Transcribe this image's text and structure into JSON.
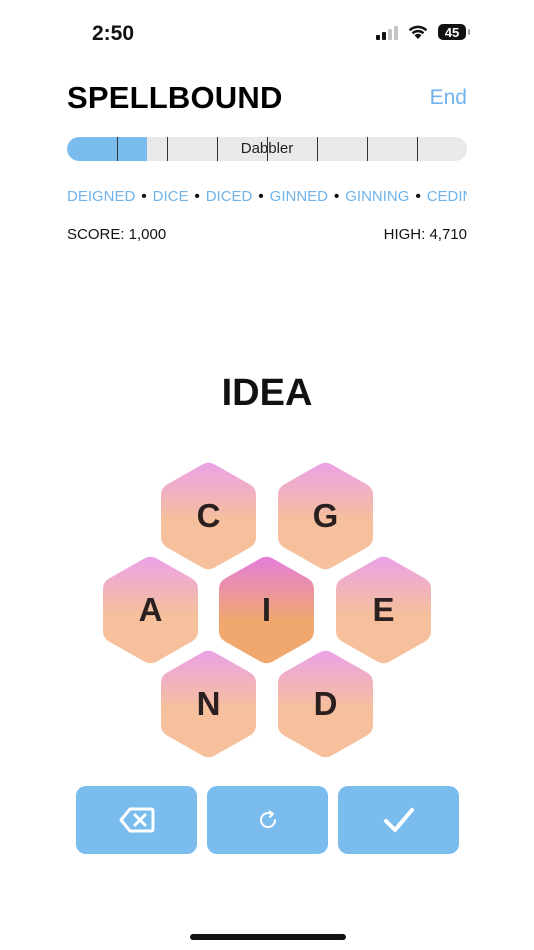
{
  "status": {
    "time": "2:50",
    "battery": "45",
    "icons": [
      "cellular-signal-icon",
      "wifi-icon",
      "battery-icon"
    ]
  },
  "header": {
    "title": "SPELLBOUND",
    "end_label": "End"
  },
  "progress": {
    "rank": "Dabbler",
    "fraction": 0.2
  },
  "found_words": [
    "DEIGNED",
    "DICE",
    "DICED",
    "GINNED",
    "GINNING",
    "CEDING"
  ],
  "score": {
    "label": "SCORE: 1,000",
    "high_label": "HIGH: 4,710"
  },
  "current_word": "IDEA",
  "letters": {
    "center": "I",
    "outer": [
      "C",
      "G",
      "A",
      "E",
      "N",
      "D"
    ]
  },
  "colors": {
    "accent": "#7BBCEF",
    "link": "#6FB3EA",
    "tile_top": "#EBA2E6",
    "tile_bottom": "#F5C09B",
    "center_top": "#E47DDA",
    "center_bottom": "#F0A86E"
  },
  "buttons": {
    "delete_icon": "backspace-icon",
    "shuffle_icon": "shuffle-icon",
    "submit_icon": "checkmark-icon"
  }
}
